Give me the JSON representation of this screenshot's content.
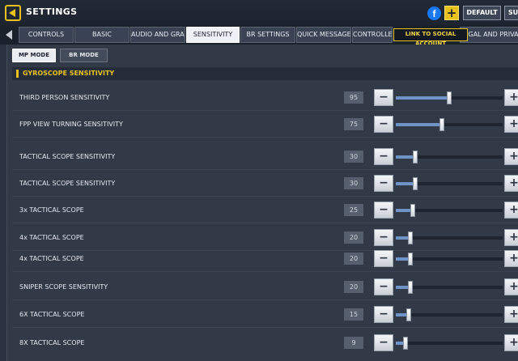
{
  "header": {
    "title": "SETTINGS",
    "facebook_icon": "f",
    "add_icon": "+",
    "default_label": "DEFAULT",
    "cutoff_label": "SU"
  },
  "tabs": [
    {
      "label": "CONTROLS",
      "active": false
    },
    {
      "label": "BASIC",
      "active": false
    },
    {
      "label": "AUDIO AND GRAPHICS",
      "active": false
    },
    {
      "label": "SENSITIVITY",
      "active": true
    },
    {
      "label": "BR SETTINGS",
      "active": false
    },
    {
      "label": "QUICK MESSAGE",
      "active": false
    },
    {
      "label": "CONTROLLE",
      "active": false
    },
    {
      "label": "LEGAL AND PRIVACY",
      "active": false
    }
  ],
  "tooltip": "LINK TO SOCIAL ACCOUNT",
  "modes": [
    {
      "label": "MP MODE",
      "active": true
    },
    {
      "label": "BR MODE",
      "active": false
    }
  ],
  "section": {
    "title": "GYROSCOPE SENSITIVITY"
  },
  "rows": [
    {
      "label": "THIRD PERSON SENSITIVITY",
      "value": "95",
      "fraction": 0.5
    },
    {
      "label": "FPP VIEW TURNING SENSITIVITY",
      "value": "75",
      "fraction": 0.43
    },
    {
      "label": "TACTICAL SCOPE SENSITIVITY",
      "value": "30",
      "fraction": 0.18
    },
    {
      "label": "TACTICAL SCOPE SENSITIVITY",
      "value": "30",
      "fraction": 0.18
    },
    {
      "label": "3x TACTICAL SCOPE",
      "value": "25",
      "fraction": 0.16
    },
    {
      "label": "4x TACTICAL SCOPE",
      "value": "20",
      "fraction": 0.14
    },
    {
      "label": "4x TACTICAL SCOPE",
      "value": "20",
      "fraction": 0.14
    },
    {
      "label": "SNIPER SCOPE SENSITIVITY",
      "value": "20",
      "fraction": 0.14
    },
    {
      "label": "6X TACTICAL SCOPE",
      "value": "15",
      "fraction": 0.12
    },
    {
      "label": "8X TACTICAL SCOPE",
      "value": "9",
      "fraction": 0.09
    }
  ],
  "controls": {
    "minus": "−",
    "plus": "+"
  },
  "colors": {
    "accent": "#e7c21e",
    "slider_fill": "#6f93c7",
    "active_tab": "#eef1f5"
  }
}
